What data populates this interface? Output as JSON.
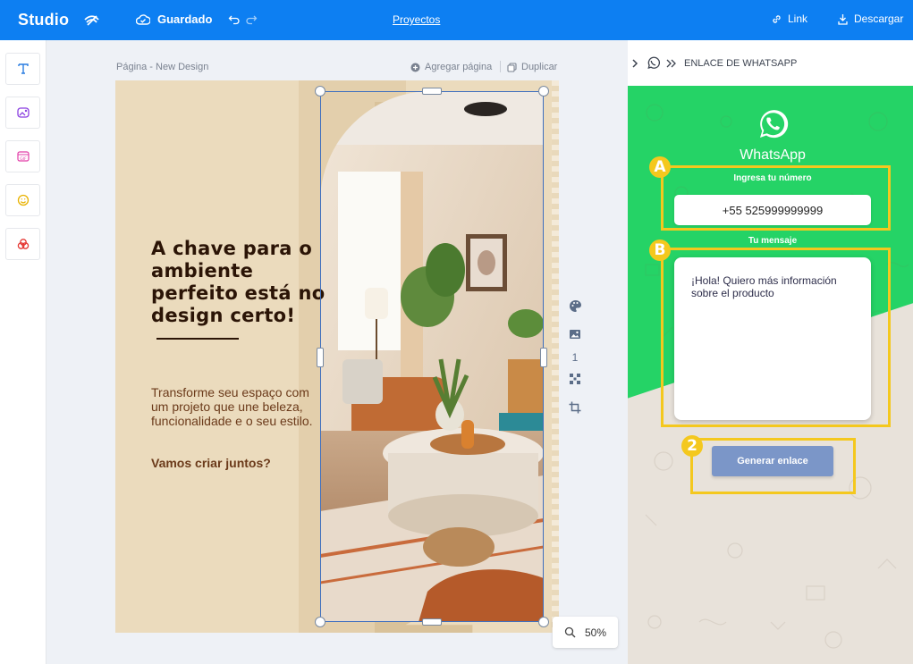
{
  "topbar": {
    "brand": "Studio",
    "status_label": "Guardado",
    "projects_label": "Proyectos",
    "link_label": "Link",
    "download_label": "Descargar"
  },
  "tools": [
    "text-tool-icon",
    "image-tool-icon",
    "gif-tool-icon",
    "emoji-tool-icon",
    "color-tool-icon"
  ],
  "canvas": {
    "page_label": "Página - New Design",
    "add_page_label": "Agregar página",
    "duplicate_label": "Duplicar",
    "page_number": "1",
    "zoom": "50%"
  },
  "design": {
    "headline": "A chave para o ambiente perfeito está no design certo!",
    "body": "Transforme seu espaço com um projeto que une beleza, funcionalidade e o seu estilo.",
    "cta": "Vamos criar juntos?"
  },
  "panel": {
    "title": "ENLACE DE WHATSAPP",
    "brand": "WhatsApp",
    "number_label": "Ingresa tu número",
    "number_value": "+55 525999999999",
    "message_label": "Tu mensaje",
    "message_value": "¡Hola! Quiero más información sobre el producto",
    "button_label": "Generar enlace",
    "markers": [
      "A",
      "B",
      "2"
    ]
  },
  "colors": {
    "topbar": "#0d7ff2",
    "whatsapp_green": "#25d366",
    "highlight": "#f4c81e",
    "button": "#7b96c8",
    "design_bg": "#ebdbbd",
    "headline": "#2b1406"
  }
}
